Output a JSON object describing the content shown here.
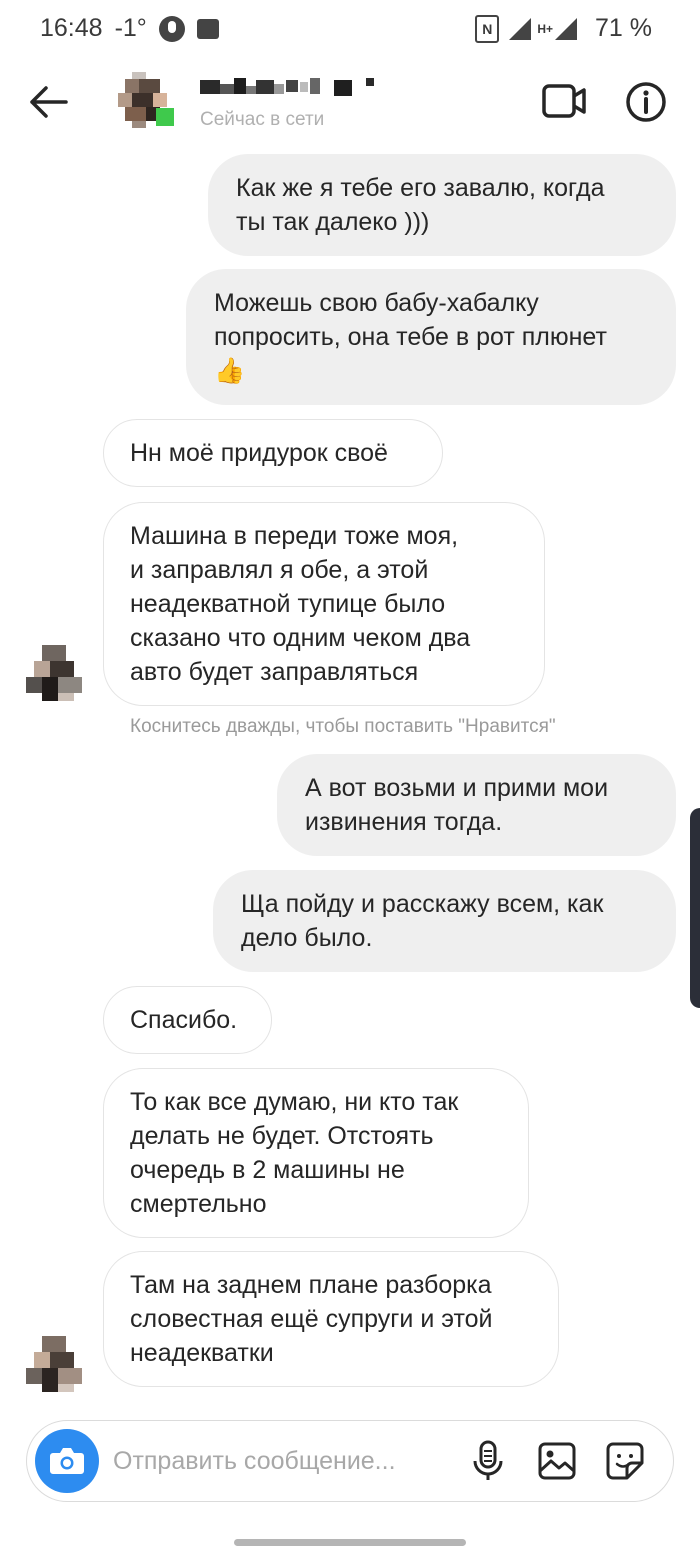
{
  "status_bar": {
    "time": "16:48",
    "temperature": "-1°",
    "battery": "71 %",
    "network": "H+"
  },
  "header": {
    "back_icon": "arrow-left-icon",
    "status_text": "Сейчас в сети",
    "video_icon": "video-camera-icon",
    "info_icon": "info-icon",
    "online_color": "#3fc94c"
  },
  "messages": [
    {
      "side": "out",
      "text": "Как же я тебе его завалю, когда\nты так далеко )))"
    },
    {
      "side": "out",
      "text": "Можешь свою бабу-хабалку\nпопросить, она тебе в рот плюнет\n👍"
    },
    {
      "side": "in",
      "text": "Нн моё придурок своё"
    },
    {
      "side": "in",
      "text": "Машина в переди тоже моя,\nи заправлял я обе, а этой\nнеадекватной тупице было\nсказано что одним чеком два\nавто будет заправляться"
    },
    {
      "side": "out",
      "text": "А вот возьми и прими мои\nизвинения тогда."
    },
    {
      "side": "out",
      "text": "Ща пойду и расскажу всем, как\nдело было."
    },
    {
      "side": "in",
      "text": "Спасибо."
    },
    {
      "side": "in",
      "text": "То как все думаю, ни кто так\nделать не будет. Отстоять\nочередь в 2 машины не\nсмертельно"
    },
    {
      "side": "in",
      "text": "Там на заднем плане разборка\nсловестная ещё супруги и этой\nнеадекватки"
    }
  ],
  "like_hint": "Коснитесь дважды, чтобы поставить \"Нравится\"",
  "composer": {
    "placeholder": "Отправить сообщение...",
    "camera_icon": "camera-icon",
    "mic_icon": "microphone-icon",
    "gallery_icon": "gallery-icon",
    "sticker_icon": "sticker-icon",
    "accent_color": "#2d8cf0"
  }
}
